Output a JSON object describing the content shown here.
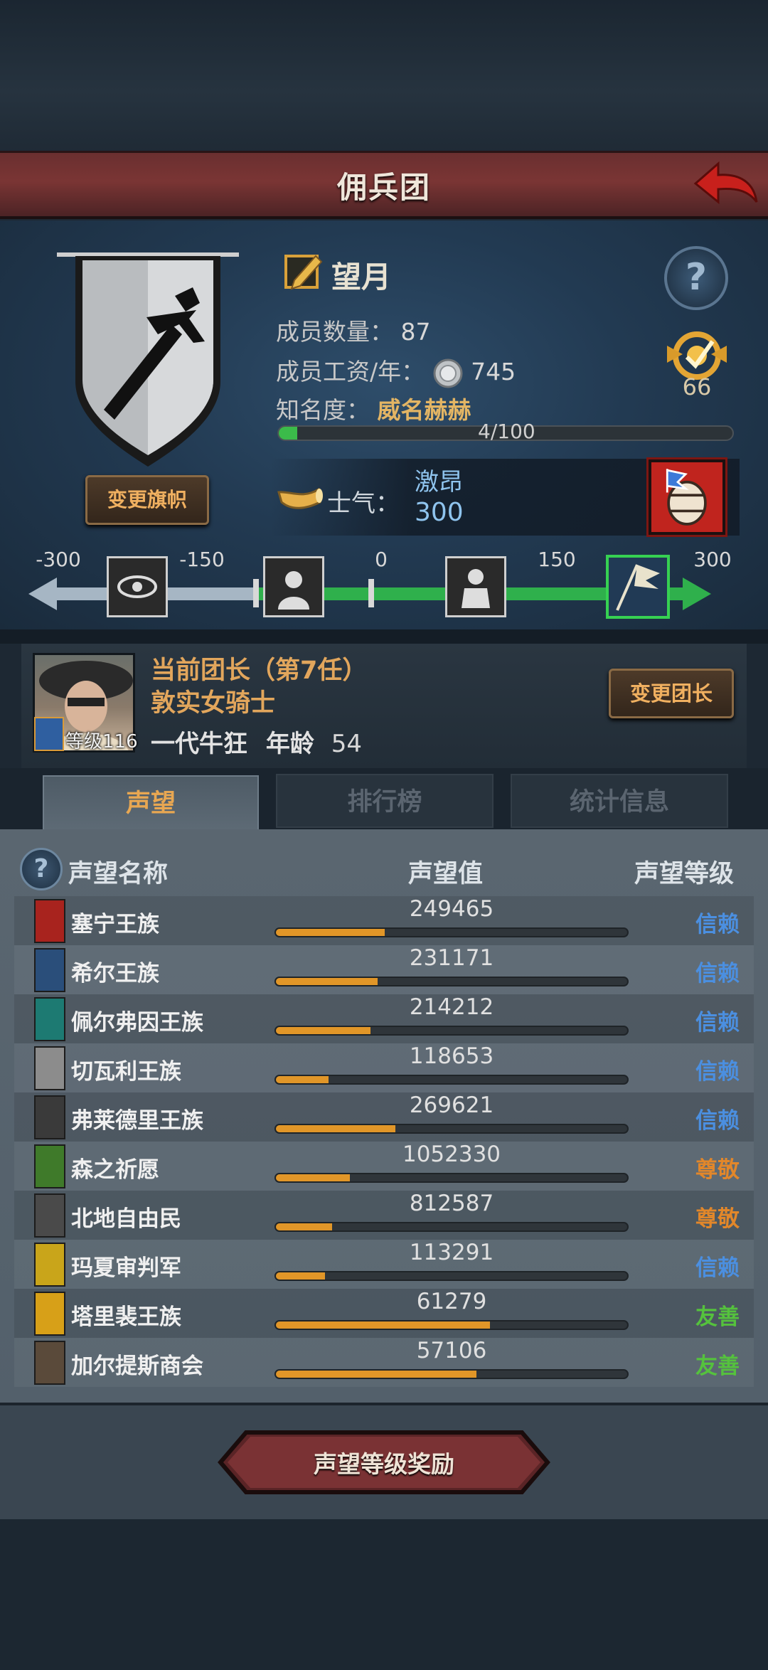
{
  "header": {
    "title": "佣兵团"
  },
  "guild": {
    "name": "望月",
    "change_flag_label": "变更旗帜",
    "members_label": "成员数量：",
    "members_value": "87",
    "salary_label": "成员工资/年：",
    "salary_value": "745",
    "fame_label": "知名度：",
    "fame_value": "威名赫赫",
    "fame_progress_text": "4/100",
    "fame_progress": 0.04,
    "badge_value": "66"
  },
  "morale": {
    "label": "士气：",
    "state": "激昂",
    "value": "300",
    "scale_ticks": [
      "-300",
      "-150",
      "0",
      "150",
      "300"
    ]
  },
  "leader": {
    "title": "当前团长（第7任）",
    "name": "敦实女骑士",
    "level_text": "等级116",
    "info": "一代牛狂",
    "age_label": "年龄",
    "age_value": "54",
    "change_leader_label": "变更团长"
  },
  "tabs": [
    {
      "label": "声望",
      "active": true
    },
    {
      "label": "排行榜",
      "active": false
    },
    {
      "label": "统计信息",
      "active": false
    }
  ],
  "table": {
    "col_name": "声望名称",
    "col_value": "声望值",
    "col_level": "声望等级",
    "rows": [
      {
        "name": "塞宁王族",
        "value": "249465",
        "fill": 0.31,
        "level": "信赖",
        "level_color": "#4b8fe0",
        "icon_color": "#a8231e"
      },
      {
        "name": "希尔王族",
        "value": "231171",
        "fill": 0.29,
        "level": "信赖",
        "level_color": "#4b8fe0",
        "icon_color": "#2a4e7a"
      },
      {
        "name": "佩尔弗因王族",
        "value": "214212",
        "fill": 0.27,
        "level": "信赖",
        "level_color": "#4b8fe0",
        "icon_color": "#1d7a72"
      },
      {
        "name": "切瓦利王族",
        "value": "118653",
        "fill": 0.15,
        "level": "信赖",
        "level_color": "#4b8fe0",
        "icon_color": "#8c8c8c"
      },
      {
        "name": "弗莱德里王族",
        "value": "269621",
        "fill": 0.34,
        "level": "信赖",
        "level_color": "#4b8fe0",
        "icon_color": "#3a3a3a"
      },
      {
        "name": "森之祈愿",
        "value": "1052330",
        "fill": 0.21,
        "level": "尊敬",
        "level_color": "#e2872a",
        "icon_color": "#3f7a2a"
      },
      {
        "name": "北地自由民",
        "value": "812587",
        "fill": 0.16,
        "level": "尊敬",
        "level_color": "#e2872a",
        "icon_color": "#4a4a4a"
      },
      {
        "name": "玛夏审判军",
        "value": "113291",
        "fill": 0.14,
        "level": "信赖",
        "level_color": "#4b8fe0",
        "icon_color": "#c9a51a"
      },
      {
        "name": "塔里裴王族",
        "value": "61279",
        "fill": 0.61,
        "level": "友善",
        "level_color": "#55c23d",
        "icon_color": "#d7a018"
      },
      {
        "name": "加尔提斯商会",
        "value": "57106",
        "fill": 0.57,
        "level": "友善",
        "level_color": "#55c23d",
        "icon_color": "#5a4a3a"
      }
    ]
  },
  "footer": {
    "reward_label": "声望等级奖励"
  }
}
